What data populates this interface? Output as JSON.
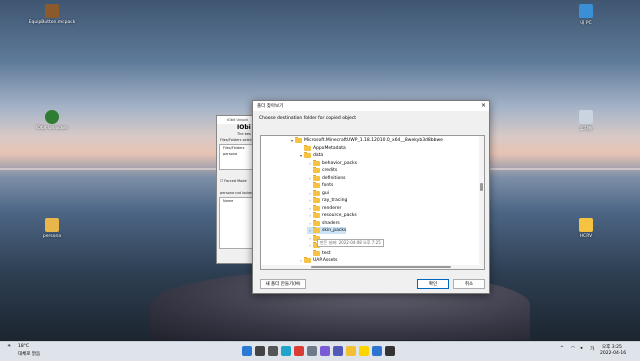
{
  "desktop": {
    "icons": [
      {
        "label": "EquipButton.mcpack",
        "color": "#8b5a2b"
      },
      {
        "label": "IObit Unlocker",
        "color": "#2e7d32"
      },
      {
        "label": "persona",
        "color": "#e8b64a"
      },
      {
        "label": "내 PC",
        "color": "#3b8fd6"
      },
      {
        "label": "휴지통",
        "color": "#c9d4e0"
      },
      {
        "label": "HCRV",
        "color": "#f5c242"
      }
    ]
  },
  "bg_window": {
    "title": "IObit Unlock",
    "brand": "IObi",
    "subtitle": "The bes",
    "label_files": "Files/Folders select",
    "col_files": "Files/Folders",
    "row_persona": "persona",
    "forced_mode": "Forced Mode",
    "uni": "Uni",
    "not_locked": "persona not locked",
    "col_name": "Name"
  },
  "dialog": {
    "title": "폴더 찾아보기",
    "description": "Choose destination folder for copied object",
    "tree": [
      {
        "label": "Microsoft.MinecraftUWP_1.18.12010.0_x64__8wekyb3d8bbwe",
        "level": 0,
        "expander": "▾"
      },
      {
        "label": "AppxMetadata",
        "level": 1,
        "expander": ""
      },
      {
        "label": "data",
        "level": 1,
        "expander": "▾"
      },
      {
        "label": "behavior_packs",
        "level": 2,
        "expander": "›"
      },
      {
        "label": "credits",
        "level": 2,
        "expander": ""
      },
      {
        "label": "definitions",
        "level": 2,
        "expander": "›"
      },
      {
        "label": "fonts",
        "level": 2,
        "expander": ""
      },
      {
        "label": "gui",
        "level": 2,
        "expander": "›"
      },
      {
        "label": "ray_tracing",
        "level": 2,
        "expander": "›"
      },
      {
        "label": "renderer",
        "level": 2,
        "expander": "›"
      },
      {
        "label": "resource_packs",
        "level": 2,
        "expander": "›"
      },
      {
        "label": "shaders",
        "level": 2,
        "expander": "›"
      },
      {
        "label": "skin_packs",
        "level": 2,
        "expander": "›",
        "selected": true
      },
      {
        "label": "",
        "level": 2,
        "expander": "›"
      },
      {
        "label": "",
        "level": 2,
        "expander": "›"
      },
      {
        "label": "test",
        "level": 2,
        "expander": ""
      },
      {
        "label": "UAP.Assets",
        "level": 1,
        "expander": "›"
      }
    ],
    "tooltip": "만든 날짜: 2022-04-08 오후 7:25",
    "new_folder_button": "새 폴더 만들기(M)",
    "ok_button": "확인",
    "cancel_button": "취소"
  },
  "taskbar": {
    "weather_temp": "18°C",
    "weather_desc": "대체로 맑음",
    "language": "가",
    "time": "오후 3:25",
    "date": "2022-04-16",
    "apps": [
      {
        "name": "windows-start-icon",
        "color": "#2a7ad5"
      },
      {
        "name": "search-icon",
        "color": "#444444"
      },
      {
        "name": "task-view-icon",
        "color": "#555555"
      },
      {
        "name": "edge-icon",
        "color": "#1fa5c9"
      },
      {
        "name": "chrome-icon",
        "color": "#d93d35"
      },
      {
        "name": "settings-icon",
        "color": "#6f7b88"
      },
      {
        "name": "photos-icon",
        "color": "#7a5bd6"
      },
      {
        "name": "teams-icon",
        "color": "#5058b8"
      },
      {
        "name": "file-explorer-icon",
        "color": "#f2c033"
      },
      {
        "name": "kakaotalk-icon",
        "color": "#ffd500"
      },
      {
        "name": "store-icon",
        "color": "#2d74d0"
      },
      {
        "name": "app-icon",
        "color": "#333333"
      }
    ]
  }
}
